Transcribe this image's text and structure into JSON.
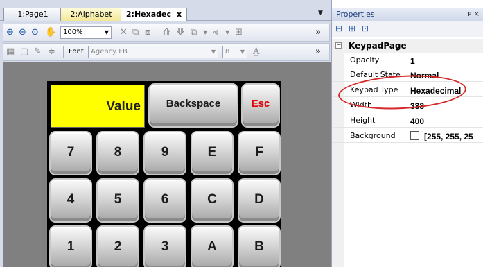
{
  "tabs": [
    {
      "label": "1:Page1"
    },
    {
      "label": "2:Alphabet"
    },
    {
      "label": "2:Hexadec"
    }
  ],
  "tab_close_glyph": "x",
  "tab_dropdown_glyph": "▼",
  "toolbar": {
    "zoom_value": "100%",
    "font_label": "Font",
    "font_value": "Agency FB",
    "font_size_value": "8",
    "more_glyph": "»"
  },
  "keypad": {
    "value_label": "Value",
    "backspace_label": "Backspace",
    "esc_label": "Esc",
    "rows": [
      [
        "7",
        "8",
        "9",
        "E",
        "F"
      ],
      [
        "4",
        "5",
        "6",
        "C",
        "D"
      ],
      [
        "1",
        "2",
        "3",
        "A",
        "B"
      ]
    ],
    "value_color": "#ffff00",
    "esc_color": "#e00000"
  },
  "properties": {
    "title": "Properties",
    "pin_glyph": "ᴘ ×",
    "category": "KeypadPage",
    "category_toggle": "−",
    "rows": [
      {
        "name": "Opacity",
        "value": "1"
      },
      {
        "name": "Default State",
        "value": "Normal"
      },
      {
        "name": "Keypad Type",
        "value": "Hexadecimal"
      },
      {
        "name": "Width",
        "value": "338"
      },
      {
        "name": "Height",
        "value": "400"
      },
      {
        "name": "Background",
        "value": "[255, 255, 25"
      }
    ],
    "highlight_color": "#d62828"
  }
}
